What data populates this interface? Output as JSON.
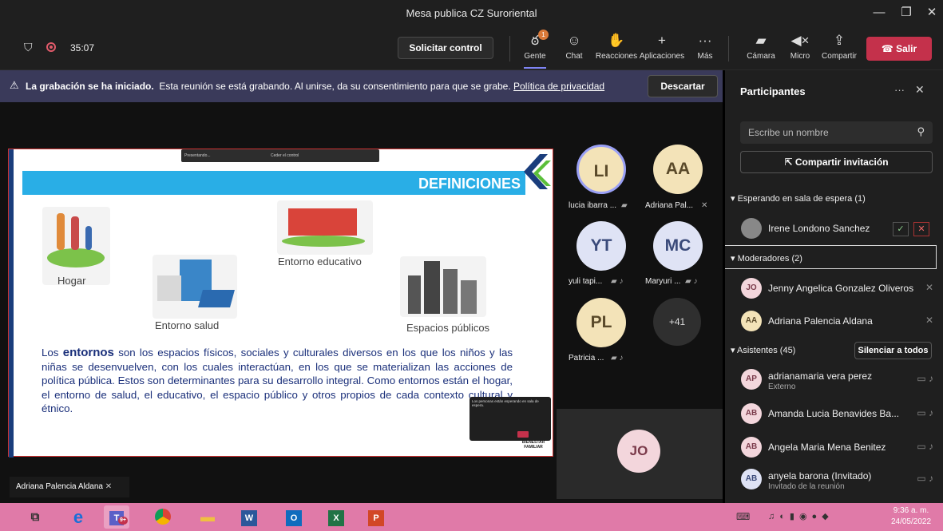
{
  "window": {
    "title": "Mesa publica CZ Suroriental",
    "minimize": "—",
    "maximize": "❐",
    "close": "✕"
  },
  "topbar": {
    "timer": "35:07",
    "solicitar_control": "Solicitar control",
    "items": [
      {
        "label": "Gente",
        "icon": "people-icon",
        "badge": "1"
      },
      {
        "label": "Chat",
        "icon": "chat-icon"
      },
      {
        "label": "Reacciones",
        "icon": "reactions-icon"
      },
      {
        "label": "Aplicaciones",
        "icon": "add-icon"
      },
      {
        "label": "Más",
        "icon": "more-icon"
      },
      {
        "label": "Cámara",
        "icon": "camera-off-icon"
      },
      {
        "label": "Micro",
        "icon": "mic-off-icon"
      },
      {
        "label": "Compartir",
        "icon": "share-icon"
      }
    ],
    "salir": "Salir"
  },
  "banner": {
    "bold": "La grabación se ha iniciado.",
    "text": "Esta reunión se está grabando. Al unirse, da su consentimiento para que se grabe.",
    "link": "Política de privacidad",
    "button": "Descartar"
  },
  "slide": {
    "title": "DEFINICIONES",
    "captions": [
      "Hogar",
      "Entorno salud",
      "Entorno educativo",
      "Espacios públicos"
    ],
    "text_lead": "Los ",
    "text_bold": "entornos",
    "text_body": " son los espacios físicos, sociales y culturales diversos en los que los niños y las niñas se desenvuelven, con los cuales interactúan, en los que se materializan las acciones de política pública. Estos son determinantes para su desarrollo integral. Como entornos están el hogar, el entorno de salud, el educativo, el espacio público y otros propios de cada contexto cultural y étnico.",
    "toolbar_presenting": "Presentando...",
    "toolbar_control": "Ceder el control",
    "notice": "Los personas están esperando en sala de espera.",
    "brand": "BIENESTAR FAMILIAR"
  },
  "tiles": [
    {
      "initials": "LI",
      "label": "lucia ibarra ...",
      "color": "#f3e3b8"
    },
    {
      "initials": "AA",
      "label": "Adriana Pal...",
      "color": "#f3e3b8"
    },
    {
      "initials": "YT",
      "label": "yuli tapi...",
      "color": "#dfe3f5"
    },
    {
      "initials": "MC",
      "label": "Maryuri ...",
      "color": "#dfe3f5"
    },
    {
      "initials": "PL",
      "label": "Patricia ...",
      "color": "#f3e3b8"
    }
  ],
  "more_count": "+41",
  "jo_tile": "JO",
  "speaker_label": "Adriana Palencia Aldana",
  "panel": {
    "title": "Participantes",
    "search_placeholder": "Escribe un nombre",
    "invite": "Compartir invitación",
    "waiting_header": "Esperando en sala de espera (1)",
    "waiting": [
      {
        "name": "Irene Londono Sanchez"
      }
    ],
    "moderators_header": "Moderadores (2)",
    "moderators": [
      {
        "initials": "JO",
        "name": "Jenny Angelica Gonzalez Oliveros"
      },
      {
        "initials": "AA",
        "name": "Adriana Palencia Aldana"
      }
    ],
    "attendees_header": "Asistentes (45)",
    "mute_all": "Silenciar a todos",
    "attendees": [
      {
        "initials": "AP",
        "name": "adrianamaria vera perez",
        "sub": "Externo"
      },
      {
        "initials": "AB",
        "name": "Amanda Lucia Benavides Ba...",
        "sub": ""
      },
      {
        "initials": "AB",
        "name": "Angela Maria Mena Benitez",
        "sub": ""
      },
      {
        "initials": "AB",
        "name": "anyela barona (Invitado)",
        "sub": "Invitado de la reunión"
      }
    ]
  },
  "taskbar": {
    "time": "9:36 a. m.",
    "date": "24/05/2022",
    "teams_badge": "9+"
  }
}
